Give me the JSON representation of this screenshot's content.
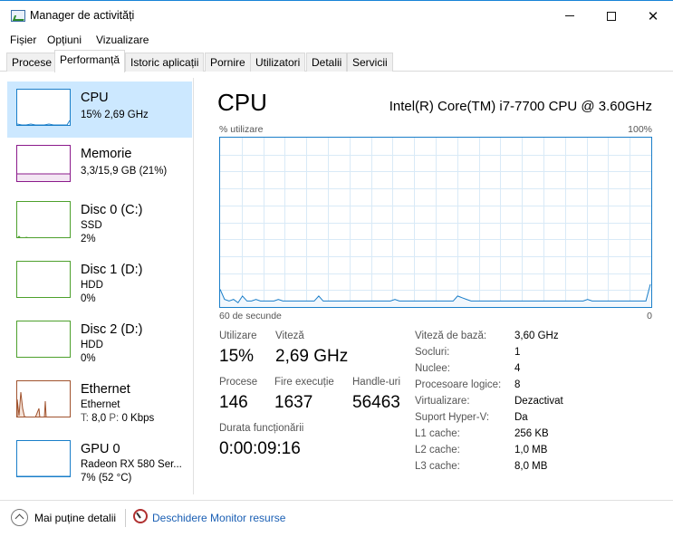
{
  "window": {
    "title": "Manager de activități"
  },
  "menu": [
    "Fișier",
    "Opțiuni",
    "Vizualizare"
  ],
  "tabs": [
    "Procese",
    "Performanță",
    "Istoric aplicații",
    "Pornire",
    "Utilizatori",
    "Detalii",
    "Servicii"
  ],
  "active_tab": "Performanță",
  "sidebar": {
    "items": [
      {
        "title": "CPU",
        "line1": "15% 2,69 GHz",
        "line2": "",
        "color": "#1a7ec9"
      },
      {
        "title": "Memorie",
        "line1": "3,3/15,9 GB (21%)",
        "line2": "",
        "color": "#8b1a8b"
      },
      {
        "title": "Disc 0 (C:)",
        "line1": "SSD",
        "line2": "2%",
        "color": "#4da02c"
      },
      {
        "title": "Disc 1 (D:)",
        "line1": "HDD",
        "line2": "0%",
        "color": "#4da02c"
      },
      {
        "title": "Disc 2 (D:)",
        "line1": "HDD",
        "line2": "0%",
        "color": "#4da02c"
      },
      {
        "title": "Ethernet",
        "line1": "Ethernet",
        "line2_prefix_t": "T:",
        "line2_t": "8,0",
        "line2_prefix_p": "P:",
        "line2_p": "0 Kbps",
        "color": "#a0522d"
      },
      {
        "title": "GPU 0",
        "line1": "Radeon RX 580 Ser...",
        "line2": "7% (52 °C)",
        "color": "#1a7ec9"
      }
    ]
  },
  "main": {
    "title": "CPU",
    "model": "Intel(R) Core(TM) i7-7700 CPU @ 3.60GHz",
    "axis_label": "% utilizare",
    "axis_max": "100%",
    "axis_time": "60 de secunde",
    "axis_min": "0",
    "stats": {
      "util_label": "Utilizare",
      "util_value": "15%",
      "speed_label": "Viteză",
      "speed_value": "2,69 GHz",
      "proc_label": "Procese",
      "proc_value": "146",
      "threads_label": "Fire execuție",
      "threads_value": "1637",
      "handles_label": "Handle-uri",
      "handles_value": "56463",
      "uptime_label": "Durata funcționării",
      "uptime_value": "0:00:09:16"
    },
    "specs": [
      {
        "label": "Viteză de bază:",
        "value": "3,60 GHz"
      },
      {
        "label": "Socluri:",
        "value": "1"
      },
      {
        "label": "Nuclee:",
        "value": "4"
      },
      {
        "label": "Procesoare logice:",
        "value": "8"
      },
      {
        "label": "Virtualizare:",
        "value": "Dezactivat"
      },
      {
        "label": "Suport Hyper-V:",
        "value": "Da"
      },
      {
        "label": "L1 cache:",
        "value": "256 KB"
      },
      {
        "label": "L2 cache:",
        "value": "1,0 MB"
      },
      {
        "label": "L3 cache:",
        "value": "8,0 MB"
      }
    ],
    "cpu_history_percent": [
      10,
      4,
      3,
      4,
      2,
      6,
      3,
      3,
      4,
      3,
      3,
      3,
      3,
      4,
      3,
      3,
      3,
      3,
      3,
      3,
      3,
      3,
      6,
      3,
      3,
      3,
      3,
      3,
      3,
      3,
      3,
      3,
      3,
      3,
      3,
      3,
      3,
      3,
      3,
      4,
      3,
      3,
      3,
      3,
      3,
      3,
      3,
      3,
      3,
      3,
      3,
      3,
      3,
      6,
      5,
      4,
      3,
      3,
      3,
      3,
      3,
      3,
      3,
      3,
      3,
      3,
      3,
      3,
      3,
      3,
      3,
      3,
      3,
      3,
      3,
      3,
      3,
      3,
      3,
      3,
      3,
      3,
      4,
      3,
      3,
      3,
      3,
      3,
      3,
      3,
      3,
      3,
      3,
      3,
      3,
      3,
      13
    ],
    "line_color": "#1a7ec9"
  },
  "footer": {
    "less_details": "Mai puține detalii",
    "resource_monitor": "Deschidere Monitor resurse"
  }
}
